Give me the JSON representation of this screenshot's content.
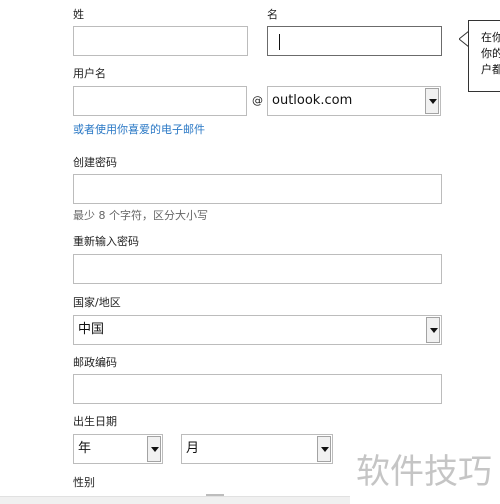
{
  "name": {
    "surname_label": "姓",
    "given_label": "名"
  },
  "username": {
    "label": "用户名",
    "at_symbol": "@",
    "domain_value": "outlook.com",
    "alt_email_link": "或者使用你喜爱的电子邮件"
  },
  "password": {
    "label": "创建密码",
    "hint": "最少 8 个字符，区分大小写"
  },
  "confirm_password": {
    "label": "重新输入密码"
  },
  "country": {
    "label": "国家/地区",
    "value": "中国"
  },
  "postal": {
    "label": "邮政编码"
  },
  "birthdate": {
    "label": "出生日期",
    "year_value": "年",
    "month_value": "月"
  },
  "gender": {
    "label": "性别"
  },
  "tooltip": {
    "text": "在你\n你的\n户都"
  },
  "watermark": {
    "text": "软件技巧"
  },
  "colors": {
    "link": "#2a78c5",
    "border": "#bcbcbc"
  }
}
